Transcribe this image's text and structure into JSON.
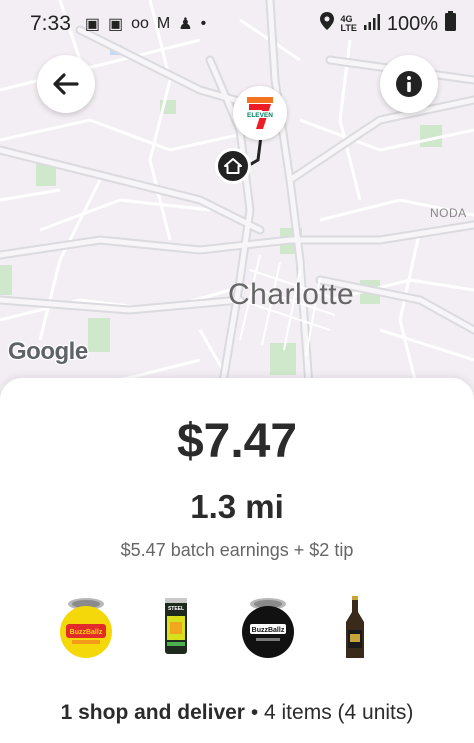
{
  "status_bar": {
    "time": "7:33",
    "battery": "100%",
    "network": "4G LTE"
  },
  "map": {
    "city_label": "Charlotte",
    "area_label": "NODA",
    "attribution": "Google",
    "store_logo_text": "ELEVEN",
    "store_logo_number": "7",
    "back_icon": "arrow-left-icon",
    "info_icon": "info-icon",
    "home_icon": "home-icon"
  },
  "offer": {
    "price": "$7.47",
    "distance": "1.3 mi",
    "earnings": "$5.47 batch earnings + $2 tip",
    "summary_bold": "1 shop and deliver",
    "summary_rest": " • 4 items (4 units)",
    "items": [
      {
        "icon": "buzzballz-yellow-can-icon",
        "name": "BuzzBallz"
      },
      {
        "icon": "steel-reserve-pineapple-can-icon",
        "name": "Steel Reserve Pineapple"
      },
      {
        "icon": "buzzballz-black-can-icon",
        "name": "BuzzBallz"
      },
      {
        "icon": "beer-bottle-icon",
        "name": "Beer bottle"
      }
    ]
  },
  "colors": {
    "map_bg": "#f3eef4",
    "road": "#ffffff",
    "park": "#cfe8cc",
    "text_dark": "#2b2b2b",
    "seven_eleven_green": "#008163",
    "seven_eleven_orange": "#f47321",
    "seven_eleven_red": "#ee1c25"
  }
}
